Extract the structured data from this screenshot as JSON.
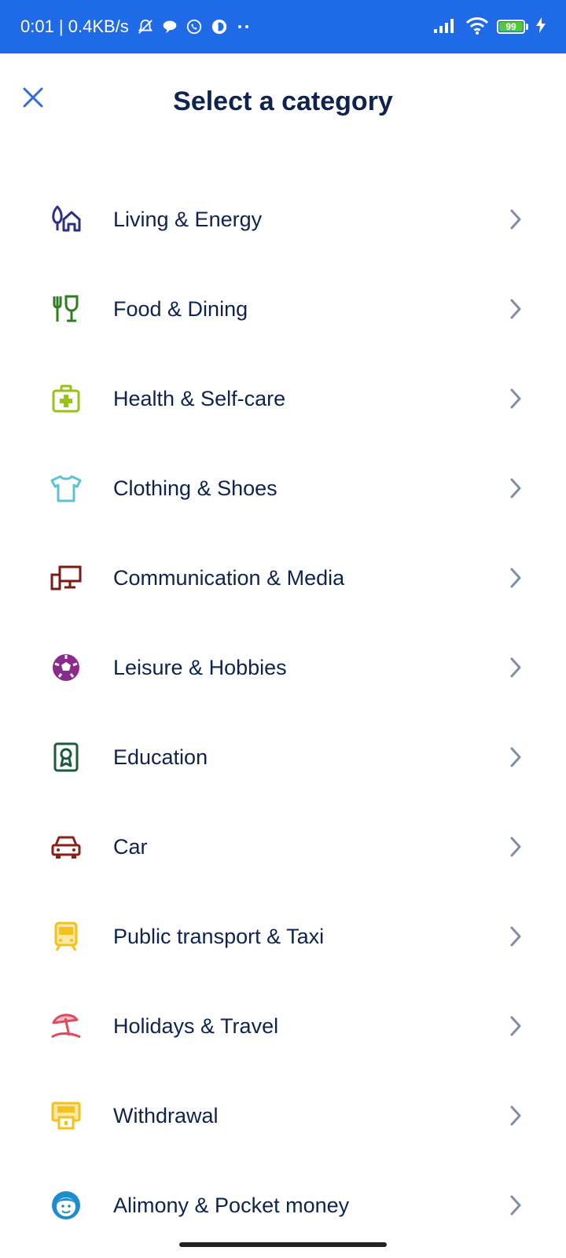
{
  "status_bar": {
    "time_speed": "0:01 | 0.4KB/s",
    "battery_level": "99",
    "icons_left": [
      "bell-off-icon",
      "chat-bubble-icon",
      "whatsapp-icon",
      "app-notification-icon",
      "more-dots-icon"
    ],
    "icons_right": [
      "signal-icon",
      "wifi-icon",
      "battery-icon",
      "charging-icon"
    ],
    "background_color": "#1f6ae6"
  },
  "header": {
    "title": "Select a category",
    "close_icon": "close-icon"
  },
  "categories": [
    {
      "label": "Living & Energy",
      "icon": "home-tree-icon",
      "color": "#2c2f86"
    },
    {
      "label": "Food & Dining",
      "icon": "fork-glass-icon",
      "color": "#2f7d1c"
    },
    {
      "label": "Health & Self-care",
      "icon": "first-aid-kit-icon",
      "color": "#98c21a"
    },
    {
      "label": "Clothing & Shoes",
      "icon": "t-shirt-icon",
      "color": "#5cc4d0"
    },
    {
      "label": "Communication & Media",
      "icon": "devices-icon",
      "color": "#7a1a12"
    },
    {
      "label": "Leisure & Hobbies",
      "icon": "soccer-ball-icon",
      "color": "#8a2a8c"
    },
    {
      "label": "Education",
      "icon": "certificate-icon",
      "color": "#1a5c3a"
    },
    {
      "label": "Car",
      "icon": "car-icon",
      "color": "#8c1f1a"
    },
    {
      "label": "Public transport & Taxi",
      "icon": "tram-icon",
      "color": "#f2c21f"
    },
    {
      "label": "Holidays & Travel",
      "icon": "beach-umbrella-icon",
      "color": "#e24a5a"
    },
    {
      "label": "Withdrawal",
      "icon": "atm-icon",
      "color": "#f2c21f"
    },
    {
      "label": "Alimony & Pocket money",
      "icon": "child-face-icon",
      "color": "#1f8ccf"
    }
  ],
  "chevron_icon": "chevron-right-icon",
  "chevron_color": "#7f8ea6"
}
